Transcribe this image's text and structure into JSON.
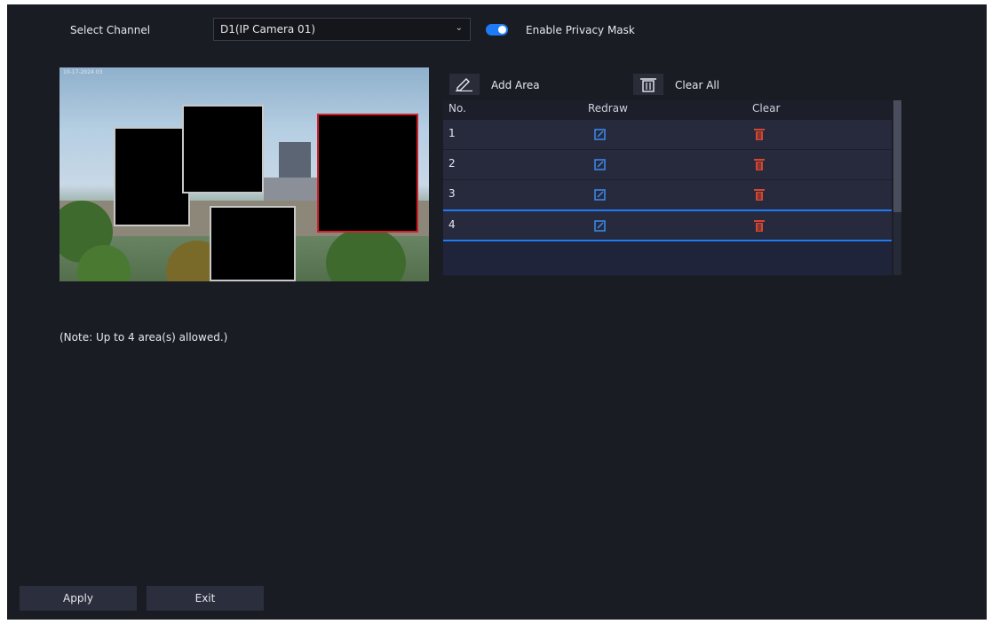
{
  "channel": {
    "label": "Select Channel",
    "selected": "D1(IP Camera 01)"
  },
  "privacy_mask": {
    "label": "Enable Privacy Mask",
    "enabled": true
  },
  "preview": {
    "overlay_text": "10-17-2024 03"
  },
  "toolbar": {
    "add_area_label": "Add Area",
    "clear_all_label": "Clear All"
  },
  "table": {
    "headers": [
      "No.",
      "Redraw",
      "Clear"
    ],
    "rows": [
      {
        "no": "1"
      },
      {
        "no": "2"
      },
      {
        "no": "3"
      },
      {
        "no": "4"
      }
    ],
    "selected_row": "4"
  },
  "note": "(Note: Up to 4 area(s) allowed.)",
  "buttons": {
    "apply": "Apply",
    "exit": "Exit"
  },
  "colors": {
    "accent": "#1e7bf5",
    "delete": "#d9452e",
    "active_mask_border": "#d0212a"
  },
  "icons": {
    "add_area": "pencil-icon",
    "clear_all": "trash-icon",
    "redraw": "edit-icon",
    "clear": "delete-icon"
  }
}
